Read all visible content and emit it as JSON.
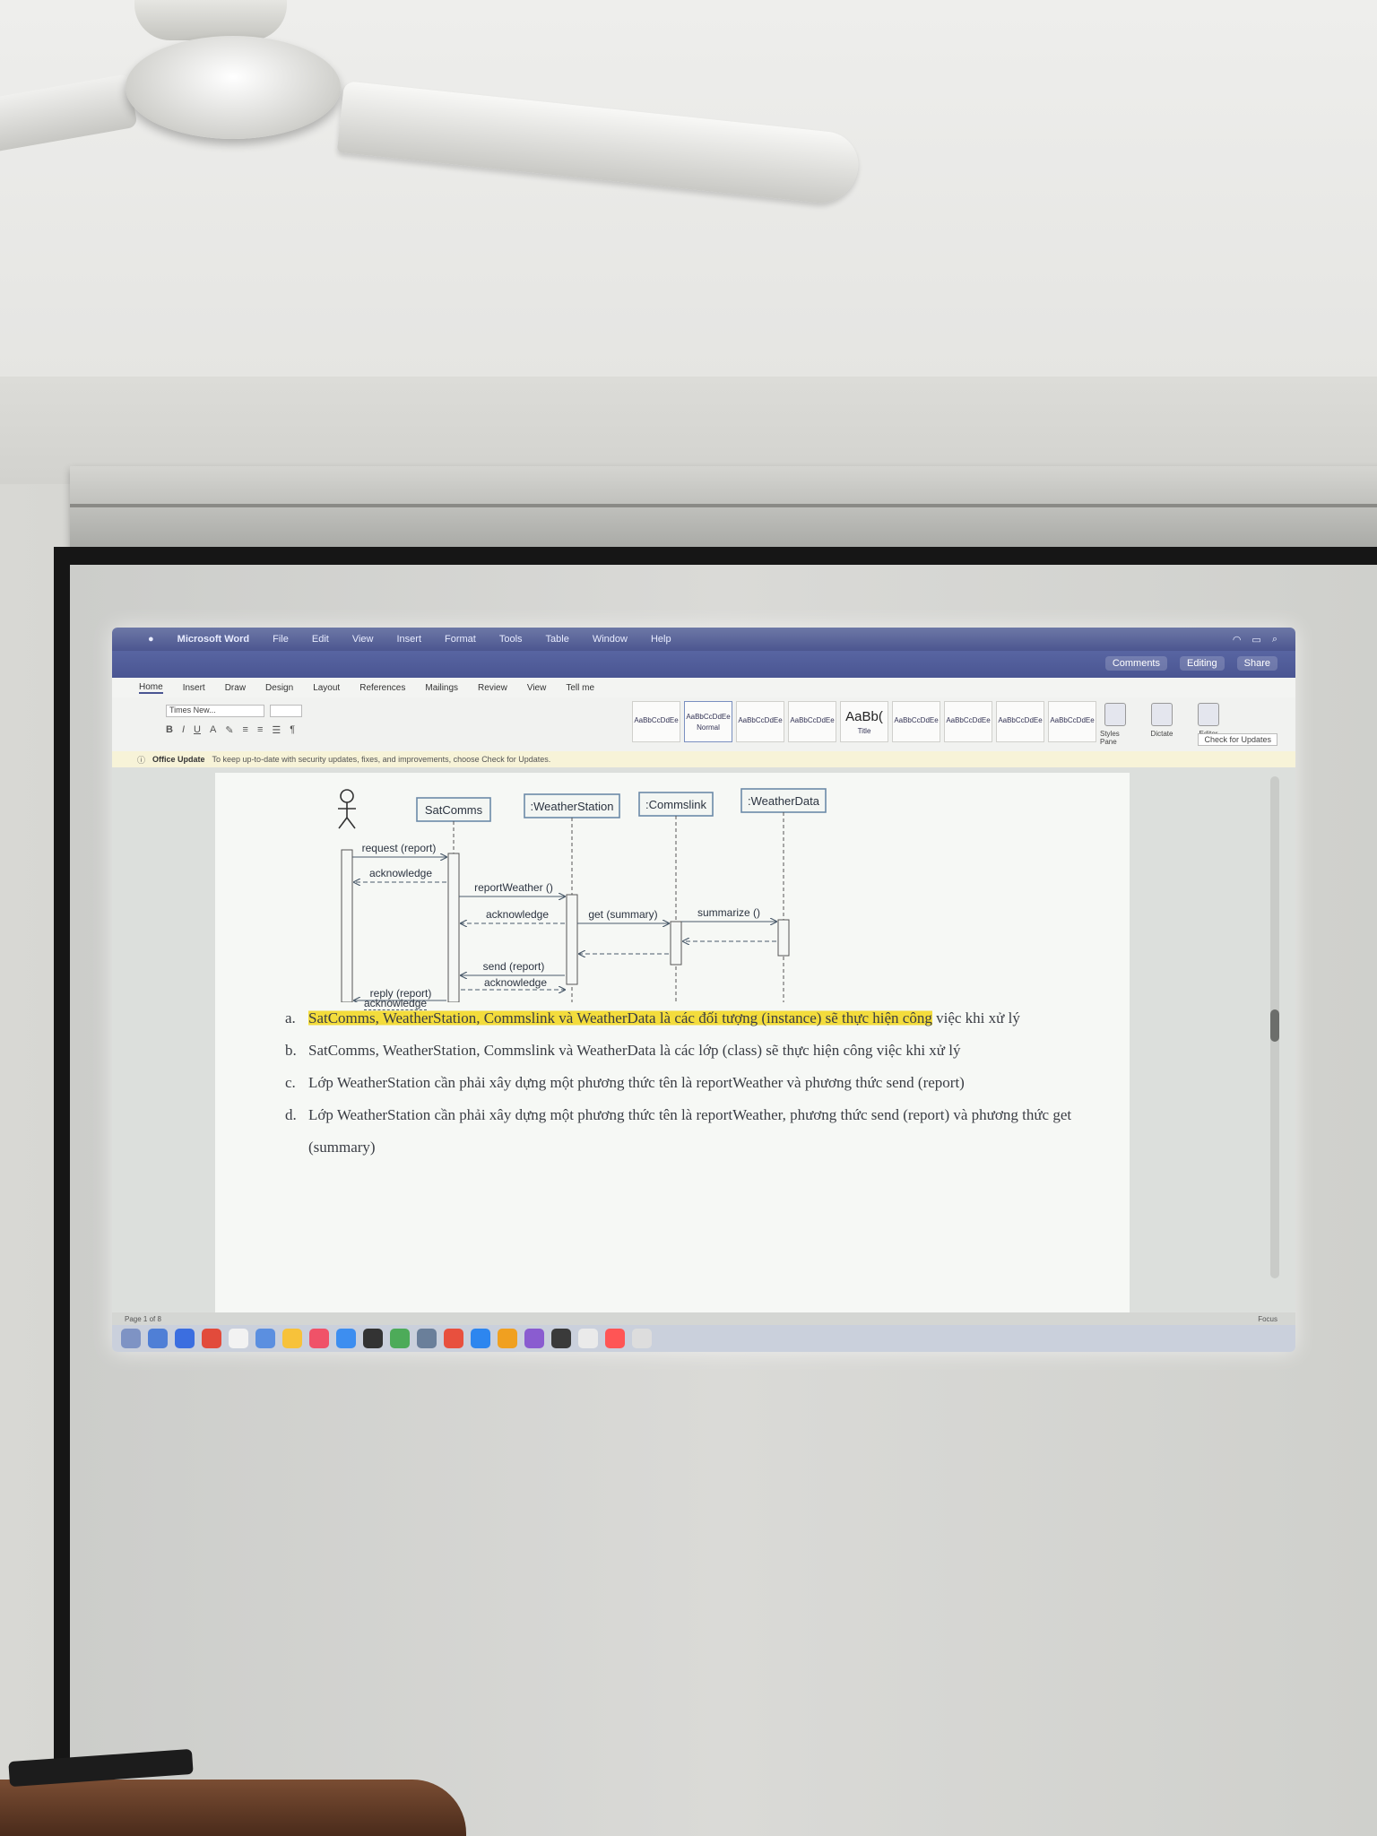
{
  "menubar": {
    "app_name": "Microsoft Word",
    "items": [
      "File",
      "Edit",
      "View",
      "Insert",
      "Format",
      "Tools",
      "Table",
      "Window",
      "Help"
    ]
  },
  "window": {
    "doc_title": "",
    "actions": [
      "Comments",
      "Editing",
      "Share"
    ]
  },
  "ribbon": {
    "tabs": [
      "Home",
      "Insert",
      "Draw",
      "Design",
      "Layout",
      "References",
      "Mailings",
      "Review",
      "View",
      "Tell me"
    ],
    "font_name": "Times New...",
    "font_size": "",
    "styles": [
      {
        "sample": "AaBbCcDdEe",
        "name": ""
      },
      {
        "sample": "AaBbCcDdEe",
        "name": "Normal"
      },
      {
        "sample": "AaBbCcDdEe",
        "name": ""
      },
      {
        "sample": "AaBbCcDdEe",
        "name": ""
      },
      {
        "sample": "AaBb(",
        "name": "Title"
      },
      {
        "sample": "AaBbCcDdEe",
        "name": ""
      },
      {
        "sample": "AaBbCcDdEe",
        "name": ""
      },
      {
        "sample": "AaBbCcDdEe",
        "name": ""
      },
      {
        "sample": "AaBbCcDdEe",
        "name": ""
      }
    ],
    "right_tools": [
      "Styles Pane",
      "Dictate",
      "Editor"
    ],
    "check_updates": "Check for Updates"
  },
  "update_bar": {
    "label": "Office Update",
    "message": "To keep up-to-date with security updates, fixes, and improvements, choose Check for Updates."
  },
  "diagram": {
    "objects": [
      "SatComms",
      ":WeatherStation",
      ":Commslink",
      ":WeatherData"
    ],
    "messages": [
      "request (report)",
      "acknowledge",
      "reportWeather ()",
      "acknowledge",
      "get (summary)",
      "summarize ()",
      "send (report)",
      "acknowledge",
      "reply (report)",
      "acknowledge"
    ]
  },
  "options": [
    {
      "letter": "a.",
      "text_highlighted": "SatComms, WeatherStation, Commslink và WeatherData là các đối tượng (instance) sẽ thực hiện công",
      "text_rest": " việc khi xử lý"
    },
    {
      "letter": "b.",
      "text": "SatComms, WeatherStation, Commslink và WeatherData là các lớp (class) sẽ thực hiện công việc khi xử lý"
    },
    {
      "letter": "c.",
      "text": "Lớp WeatherStation cần phải xây dựng một phương thức tên là reportWeather và phương thức send (report)"
    },
    {
      "letter": "d.",
      "text": "Lớp WeatherStation cần phải xây dựng một phương thức tên là reportWeather, phương thức send (report) và phương thức get (summary)"
    }
  ],
  "statusbar": {
    "left": [
      "Page 1 of 8",
      "",
      "",
      ""
    ],
    "zoom": "Focus"
  },
  "dock": {
    "icon_colors": [
      "#7e93c4",
      "#4f7fd6",
      "#3b6ee0",
      "#e24b3b",
      "#f2f2f2",
      "#5b8fe0",
      "#f7c23a",
      "#f05268",
      "#3d8ef0",
      "#333333",
      "#4dab59",
      "#6a7f9a",
      "#e8503e",
      "#2d86ef",
      "#f0a020",
      "#8a5cd0",
      "#3a3a3a",
      "#eaeaea",
      "#f55",
      "#ddd"
    ]
  }
}
